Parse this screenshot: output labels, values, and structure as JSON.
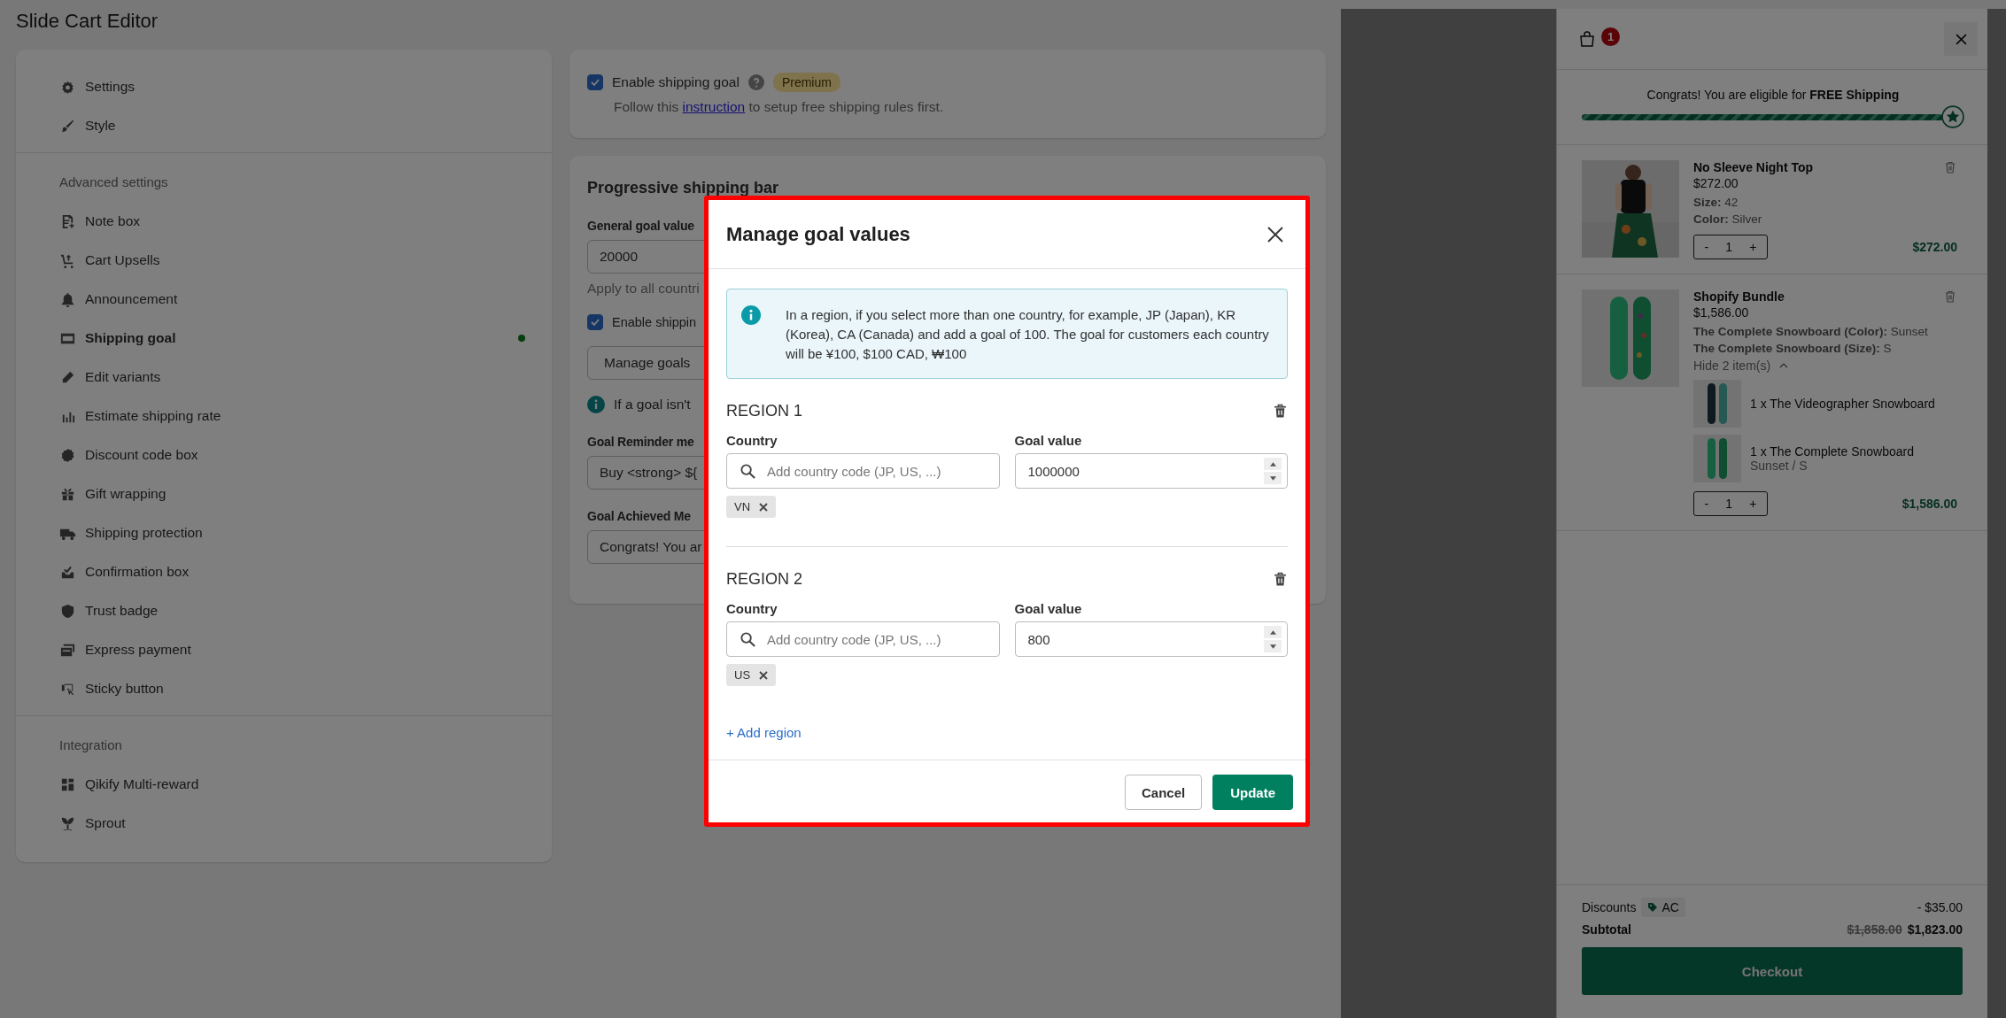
{
  "page_title": "Slide Cart Editor",
  "sidebar": {
    "groups": [
      {
        "items": [
          {
            "label": "Settings",
            "selected": false,
            "status_dot": false
          },
          {
            "label": "Style",
            "selected": false,
            "status_dot": false
          }
        ]
      },
      {
        "heading": "Advanced settings",
        "items": [
          {
            "label": "Note box",
            "selected": false,
            "status_dot": false
          },
          {
            "label": "Cart Upsells",
            "selected": false,
            "status_dot": false
          },
          {
            "label": "Announcement",
            "selected": false,
            "status_dot": false
          },
          {
            "label": "Shipping goal",
            "selected": true,
            "status_dot": true
          },
          {
            "label": "Edit variants",
            "selected": false,
            "status_dot": false
          },
          {
            "label": "Estimate shipping rate",
            "selected": false,
            "status_dot": false
          },
          {
            "label": "Discount code box",
            "selected": false,
            "status_dot": false
          },
          {
            "label": "Gift wrapping",
            "selected": false,
            "status_dot": false
          },
          {
            "label": "Shipping protection",
            "selected": false,
            "status_dot": false
          },
          {
            "label": "Confirmation box",
            "selected": false,
            "status_dot": false
          },
          {
            "label": "Trust badge",
            "selected": false,
            "status_dot": false
          },
          {
            "label": "Express payment",
            "selected": false,
            "status_dot": false
          },
          {
            "label": "Sticky button",
            "selected": false,
            "status_dot": false
          }
        ]
      },
      {
        "heading": "Integration",
        "items": [
          {
            "label": "Qikify Multi-reward",
            "selected": false,
            "status_dot": false
          },
          {
            "label": "Sprout",
            "selected": false,
            "status_dot": false
          }
        ]
      }
    ]
  },
  "shipping_goal_card": {
    "checkbox": {
      "label": "Enable shipping goal",
      "checked": true
    },
    "badge": "Premium",
    "help_before": "Follow this",
    "help_link": "instruction",
    "help_after": "to setup free shipping rules first."
  },
  "progressive_card": {
    "title": "Progressive shipping bar",
    "general_label": "General goal value",
    "general_value": "20000",
    "general_hint": "Apply to all countri",
    "checkbox": {
      "label": "Enable shippin",
      "checked": true
    },
    "manage_button": "Manage goals",
    "info_text": "If a goal isn't",
    "reminder_label": "Goal Reminder me",
    "reminder_value": "Buy <strong> ${",
    "achieved_label": "Goal Achieved Me",
    "achieved_value": "Congrats! You ar"
  },
  "modal": {
    "title": "Manage goal values",
    "info": "In a region, if you select more than one country, for example, JP (Japan), KR (Korea), CA (Canada) and add a goal of 100. The goal for customers each country will be ¥100, $100 CAD, ₩100",
    "regions": [
      {
        "title": "REGION 1",
        "country_label": "Country",
        "country_placeholder": "Add country code (JP, US, ...)",
        "goal_label": "Goal value",
        "goal_value": "1000000",
        "tags": [
          "VN"
        ]
      },
      {
        "title": "REGION 2",
        "country_label": "Country",
        "country_placeholder": "Add country code (JP, US, ...)",
        "goal_label": "Goal value",
        "goal_value": "800",
        "tags": [
          "US"
        ]
      }
    ],
    "add_region": "+ Add region",
    "cancel": "Cancel",
    "update": "Update"
  },
  "cart": {
    "count": "1",
    "progress_text_before": "Congrats! You are eligible for",
    "progress_text_bold": "FREE Shipping",
    "level": 1,
    "items": [
      {
        "name": "No Sleeve Night Top",
        "price": "$272.00",
        "options": [
          {
            "label": "Size:",
            "value": "42"
          },
          {
            "label": "Color:",
            "value": "Silver"
          }
        ],
        "minus": "-",
        "quantity": "1",
        "plus": "+",
        "total": "$272.00"
      },
      {
        "name": "Shopify Bundle",
        "price": "$1,586.00",
        "options": [
          {
            "label": "The Complete Snowboard (Color):",
            "value": "Sunset"
          },
          {
            "label": "The Complete Snowboard (Size):",
            "value": "S"
          }
        ],
        "toggle": "Hide 2 item(s)",
        "expanded": true,
        "bundle_items": [
          {
            "name": "1 x The Videographer Snowboard"
          },
          {
            "name": "1 x The Complete Snowboard",
            "variant": "Sunset / S"
          }
        ],
        "minus": "-",
        "quantity": "1",
        "plus": "+",
        "total": "$1,586.00"
      }
    ],
    "discounts_label": "Discounts",
    "discount_code": "AC",
    "discount_amount": "- $35.00",
    "subtotal_label": "Subtotal",
    "subtotal_old": "$1,858.00",
    "subtotal": "$1,823.00",
    "checkout": "Checkout"
  }
}
